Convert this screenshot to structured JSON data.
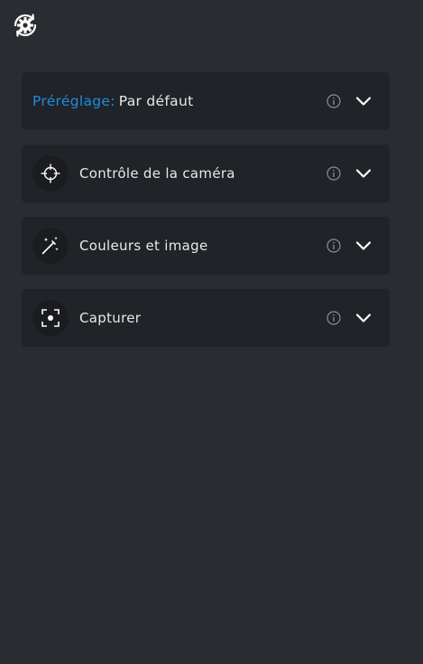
{
  "header": {
    "sync_icon": "gear-sync-icon"
  },
  "panels": {
    "preset": {
      "key_label": "Préréglage:",
      "value": "Par défaut",
      "info_icon": "info-icon",
      "chevron_icon": "chevron-down-icon"
    },
    "camera_control": {
      "label": "Contrôle de la caméra",
      "icon": "crosshair-icon"
    },
    "colors_image": {
      "label": "Couleurs et image",
      "icon": "magic-wand-icon"
    },
    "capture": {
      "label": "Capturer",
      "icon": "capture-focus-icon"
    }
  },
  "colors": {
    "background": "#292d31",
    "panel": "#202327",
    "accent": "#1e8ee0"
  }
}
